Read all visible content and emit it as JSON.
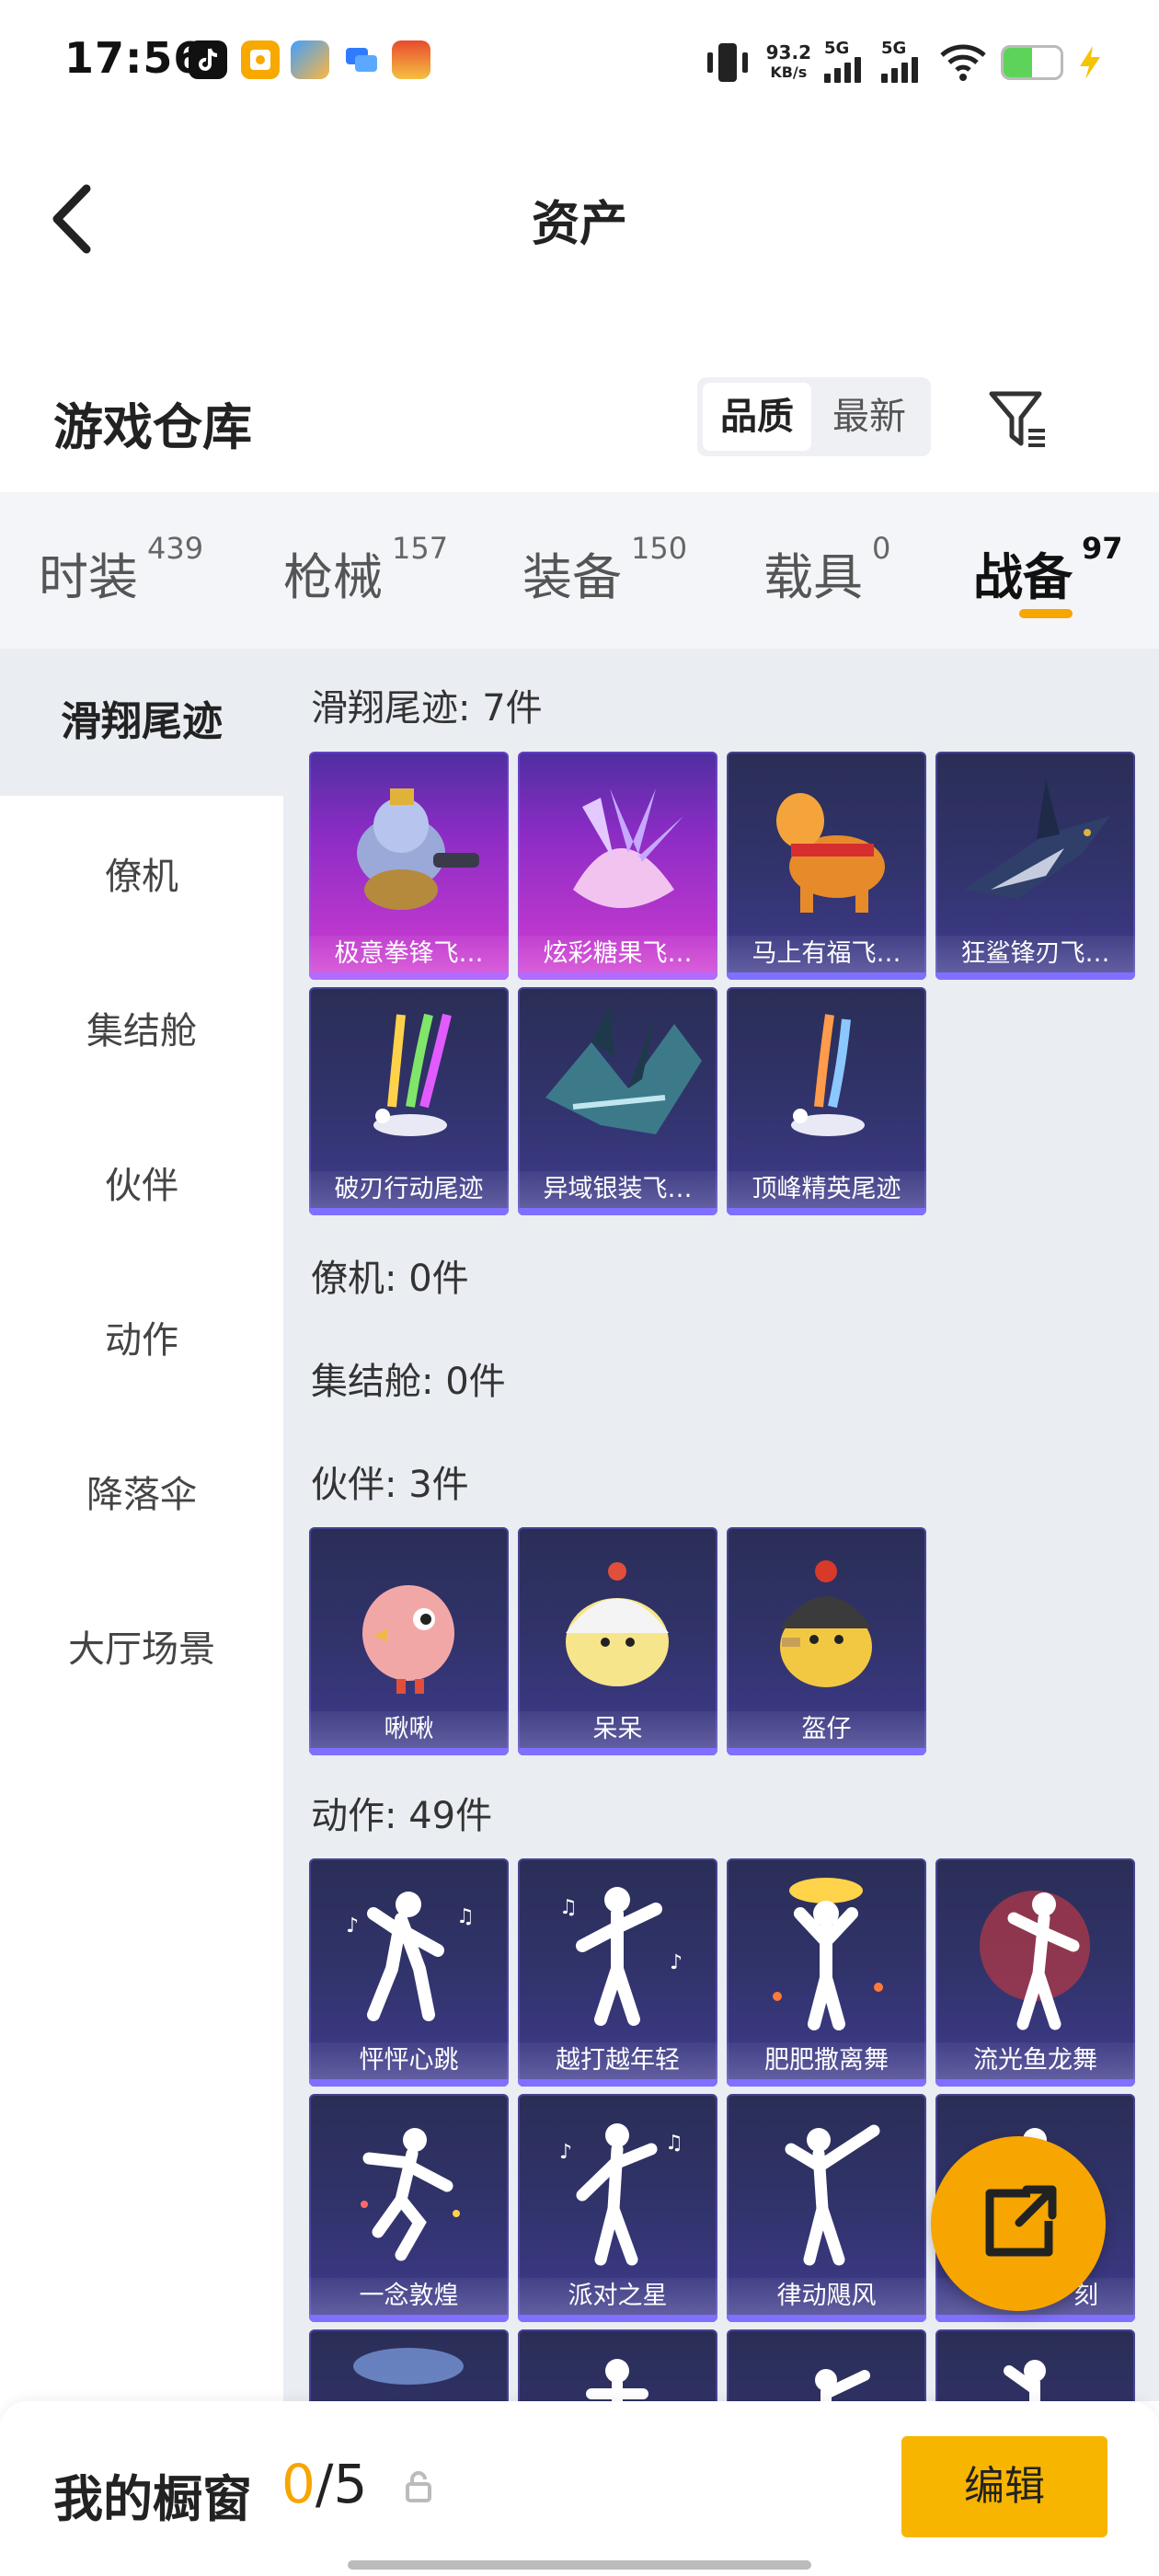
{
  "status_bar": {
    "time": "17:56",
    "net_speed_value": "93.2",
    "net_speed_unit": "KB/s",
    "sim1": "5G",
    "sim2": "5G",
    "icons": [
      "tiktok-icon",
      "app-orange-icon",
      "app-cloud-icon",
      "app-chat-icon",
      "app-game-icon",
      "vibrate-icon",
      "signal-icon",
      "wifi-icon",
      "battery-icon",
      "charging-icon"
    ],
    "battery_level": 0.5
  },
  "header": {
    "title": "资产"
  },
  "repo": {
    "title": "游戏仓库",
    "sort_options": [
      "品质",
      "最新"
    ],
    "sort_selected": "品质"
  },
  "category_tabs": [
    {
      "label": "时装",
      "count": "439"
    },
    {
      "label": "枪械",
      "count": "157"
    },
    {
      "label": "装备",
      "count": "150"
    },
    {
      "label": "载具",
      "count": "0"
    },
    {
      "label": "战备",
      "count": "97"
    }
  ],
  "active_tab": "战备",
  "sidebar": {
    "items": [
      "滑翔尾迹",
      "僚机",
      "集结舱",
      "伙伴",
      "动作",
      "降落伞",
      "大厅场景"
    ],
    "active": "滑翔尾迹"
  },
  "sections": [
    {
      "title": "滑翔尾迹: 7件",
      "items": [
        {
          "label": "极意拳锋飞…",
          "style": "purple",
          "icon": "elephant-boxer-icon"
        },
        {
          "label": "炫彩糖果飞…",
          "style": "purple",
          "icon": "candy-glider-icon"
        },
        {
          "label": "马上有福飞…",
          "style": "blue",
          "icon": "lucky-horse-icon"
        },
        {
          "label": "狂鲨锋刃飞…",
          "style": "blue",
          "icon": "shark-glider-icon"
        },
        {
          "label": "破刃行动尾迹",
          "style": "blue",
          "icon": "rainbow-trail-icon"
        },
        {
          "label": "异域银装飞…",
          "style": "blue",
          "icon": "silver-wing-icon"
        },
        {
          "label": "顶峰精英尾迹",
          "style": "blue",
          "icon": "elite-trail-icon"
        }
      ]
    },
    {
      "title": "僚机: 0件",
      "items": []
    },
    {
      "title": "集结舱: 0件",
      "items": []
    },
    {
      "title": "伙伴: 3件",
      "items": [
        {
          "label": "啾啾",
          "style": "blue",
          "icon": "pink-bird-icon"
        },
        {
          "label": "呆呆",
          "style": "blue",
          "icon": "white-chick-icon"
        },
        {
          "label": "盔仔",
          "style": "blue",
          "icon": "helmet-chick-icon"
        }
      ]
    },
    {
      "title": "动作: 49件",
      "items": [
        {
          "label": "怦怦心跳",
          "style": "blue",
          "icon": "dance-pose-icon"
        },
        {
          "label": "越打越年轻",
          "style": "blue",
          "icon": "dance-pose-icon"
        },
        {
          "label": "肥肥撒离舞",
          "style": "blue",
          "icon": "dance-pose-icon"
        },
        {
          "label": "流光鱼龙舞",
          "style": "blue",
          "icon": "dance-pose-icon"
        },
        {
          "label": "一念敦煌",
          "style": "blue",
          "icon": "dance-pose-icon"
        },
        {
          "label": "派对之星",
          "style": "blue",
          "icon": "dance-pose-icon"
        },
        {
          "label": "律动飓风",
          "style": "blue",
          "icon": "dance-pose-icon"
        },
        {
          "label": "刻",
          "style": "blue",
          "icon": "dance-pose-icon"
        }
      ]
    }
  ],
  "fab": {
    "icon": "share-external-icon"
  },
  "footer": {
    "label": "我的橱窗",
    "count_current": "0",
    "count_total": "/5",
    "edit_label": "编辑"
  }
}
